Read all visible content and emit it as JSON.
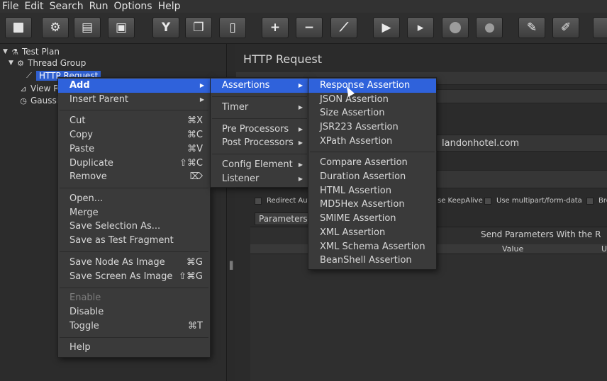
{
  "menubar": [
    "File",
    "Edit",
    "Search",
    "Run",
    "Options",
    "Help"
  ],
  "toolbar": {
    "buttons": [
      {
        "id": "new",
        "icon": "new-icon"
      },
      {
        "id": "templates",
        "icon": "templates-icon"
      },
      {
        "id": "open",
        "icon": "open-icon"
      },
      {
        "id": "save",
        "icon": "save-icon"
      },
      {
        "id": "cut",
        "icon": "cut-icon"
      },
      {
        "id": "copy",
        "icon": "copy-icon"
      },
      {
        "id": "paste",
        "icon": "paste-icon"
      },
      {
        "id": "expand",
        "icon": "plus-icon"
      },
      {
        "id": "collapse",
        "icon": "minus-icon"
      },
      {
        "id": "toggle",
        "icon": "toggle-icon"
      },
      {
        "id": "start",
        "icon": "start-icon"
      },
      {
        "id": "start-no-pause",
        "icon": "start-no-pause-icon"
      },
      {
        "id": "stop",
        "icon": "stop-icon"
      },
      {
        "id": "shutdown",
        "icon": "shutdown-icon"
      },
      {
        "id": "clear",
        "icon": "clear-icon"
      },
      {
        "id": "clear-all",
        "icon": "clear-all-icon"
      }
    ]
  },
  "tree": {
    "test_plan": "Test Plan",
    "thread_group": "Thread Group",
    "http_request": "HTTP Request",
    "view_results": "View R",
    "gaussian": "Gaussi"
  },
  "right": {
    "title": "HTTP Request",
    "server": "landonhotel.com",
    "checkboxes": {
      "redirect": "Redirect Aut",
      "keepalive": "se KeepAlive",
      "multipart": "Use multipart/form-data",
      "browser": "Bro"
    },
    "params_tab": "Parameters",
    "send_params": "Send Parameters With the R",
    "col_value": "Value",
    "col_u": "U"
  },
  "context_menu": {
    "add": "Add",
    "insert_parent": "Insert Parent",
    "cut": "Cut",
    "cut_sc": "⌘X",
    "copy": "Copy",
    "copy_sc": "⌘C",
    "paste": "Paste",
    "paste_sc": "⌘V",
    "duplicate": "Duplicate",
    "duplicate_sc": "⇧⌘C",
    "remove": "Remove",
    "remove_sc": "⌦",
    "open": "Open...",
    "merge": "Merge",
    "save_selection": "Save Selection As...",
    "save_fragment": "Save as Test Fragment",
    "save_node_image": "Save Node As Image",
    "save_node_image_sc": "⌘G",
    "save_screen_image": "Save Screen As Image",
    "save_screen_image_sc": "⇧⌘G",
    "enable": "Enable",
    "disable": "Disable",
    "toggle": "Toggle",
    "toggle_sc": "⌘T",
    "help": "Help"
  },
  "add_menu": {
    "assertions": "Assertions",
    "timer": "Timer",
    "pre_processors": "Pre Processors",
    "post_processors": "Post Processors",
    "config_element": "Config Element",
    "listener": "Listener"
  },
  "assertions_menu": [
    "Response Assertion",
    "JSON Assertion",
    "Size Assertion",
    "JSR223 Assertion",
    "XPath Assertion",
    "Compare Assertion",
    "Duration Assertion",
    "HTML Assertion",
    "MD5Hex Assertion",
    "SMIME Assertion",
    "XML Assertion",
    "XML Schema Assertion",
    "BeanShell Assertion"
  ]
}
